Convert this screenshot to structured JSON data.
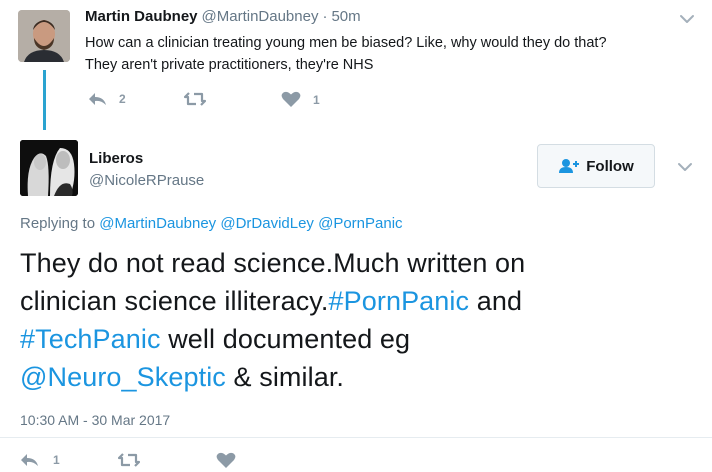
{
  "parent_tweet": {
    "author_name": "Martin Daubney",
    "author_handle": "@MartinDaubney",
    "separator": "·",
    "time_ago": "50m",
    "text_line1": "How can a clinician treating young men be biased? Like, why would they do that?",
    "text_line2": "They aren't private practitioners, they're NHS",
    "reply_count": "2",
    "retweet_count": "",
    "like_count": "1"
  },
  "main_tweet": {
    "author_name": "Liberos",
    "author_handle": "@NicoleRPrause",
    "follow_label": "Follow",
    "replying_prefix": "Replying to",
    "replying_to": [
      "@MartinDaubney",
      "@DrDavidLey",
      "@PornPanic"
    ],
    "text": {
      "line1": "They do not read science.Much written on",
      "line2_a": "clinician science illiteracy.",
      "line2_tag": "#PornPanic",
      "line2_b": " and",
      "line3_tag": "#TechPanic",
      "line3_b": " well documented eg",
      "line4_mention": "@Neuro_Skeptic",
      "line4_b": " & similar."
    },
    "timestamp": "10:30 AM - 30 Mar 2017",
    "reply_count": "1",
    "retweet_count": "",
    "like_count": ""
  },
  "colors": {
    "link": "#1b95e0",
    "thread_line": "#2aa3d0",
    "muted": "#657786",
    "icon": "#8c9aa6"
  },
  "icons": {
    "reply": "reply-icon",
    "retweet": "retweet-icon",
    "like": "heart-icon",
    "more": "chevron-down-icon",
    "follow": "add-user-icon"
  }
}
